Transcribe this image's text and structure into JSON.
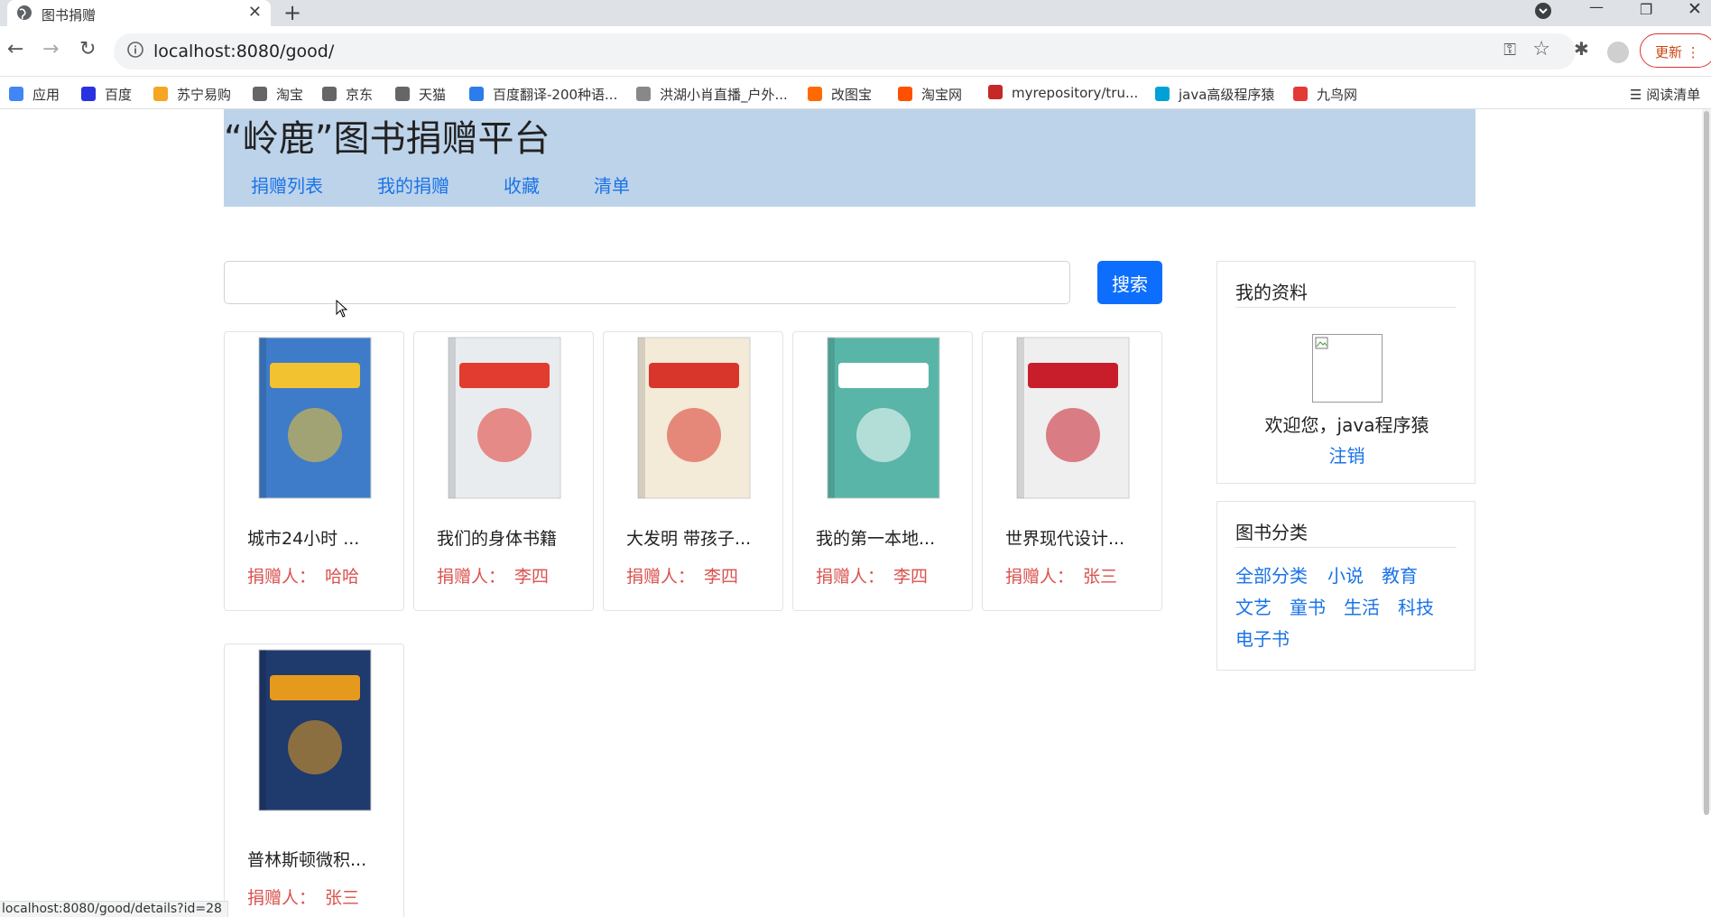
{
  "browser": {
    "tab_title": "图书捐赠",
    "url": "localhost:8080/good/",
    "update_label": "更新",
    "reading_list_label": "阅读清单",
    "status_url": "localhost:8080/good/details?id=28"
  },
  "bookmarks": [
    {
      "label": "应用",
      "color": "#4285f4"
    },
    {
      "label": "百度",
      "color": "#2932e1"
    },
    {
      "label": "苏宁易购",
      "color": "#f5a623"
    },
    {
      "label": "淘宝",
      "color": "#666666"
    },
    {
      "label": "京东",
      "color": "#666666"
    },
    {
      "label": "天猫",
      "color": "#666666"
    },
    {
      "label": "百度翻译-200种语...",
      "color": "#2b7de9"
    },
    {
      "label": "洪湖小肖直播_户外...",
      "color": "#888888"
    },
    {
      "label": "改图宝",
      "color": "#ff6a00"
    },
    {
      "label": "淘宝网",
      "color": "#ff5000"
    },
    {
      "label": "myrepository/tru...",
      "color": "#c62828"
    },
    {
      "label": "java高级程序猿",
      "color": "#00a1d6"
    },
    {
      "label": "九鸟网",
      "color": "#e53935"
    }
  ],
  "site": {
    "title": "“岭鹿”图书捐赠平台",
    "nav": [
      "捐赠列表",
      "我的捐赠",
      "收藏",
      "清单"
    ]
  },
  "search": {
    "value": "",
    "button_label": "搜索"
  },
  "donor_label": "捐赠人：",
  "books": [
    {
      "name": "城市24小时 ...",
      "donor": "哈哈",
      "cover_bg": "#3e7cc9",
      "cover_accent": "#f2c230"
    },
    {
      "name": "我们的身体书籍",
      "donor": "李四",
      "cover_bg": "#e9ecef",
      "cover_accent": "#e23b2f"
    },
    {
      "name": "大发明 带孩子...",
      "donor": "李四",
      "cover_bg": "#f3ead8",
      "cover_accent": "#d9362b"
    },
    {
      "name": "我的第一本地...",
      "donor": "李四",
      "cover_bg": "#58b5a7",
      "cover_accent": "#ffffff"
    },
    {
      "name": "世界现代设计...",
      "donor": "张三",
      "cover_bg": "#efefef",
      "cover_accent": "#c81e2b"
    },
    {
      "name": "普林斯顿微积...",
      "donor": "张三",
      "cover_bg": "#1f3a6d",
      "cover_accent": "#e59a1e"
    }
  ],
  "profile": {
    "title": "我的资料",
    "welcome": "欢迎您，java程序猿",
    "logout": "注销"
  },
  "categories": {
    "title": "图书分类",
    "items": [
      "全部分类",
      "小说",
      "教育",
      "文艺",
      "童书",
      "生活",
      "科技",
      "电子书"
    ]
  }
}
